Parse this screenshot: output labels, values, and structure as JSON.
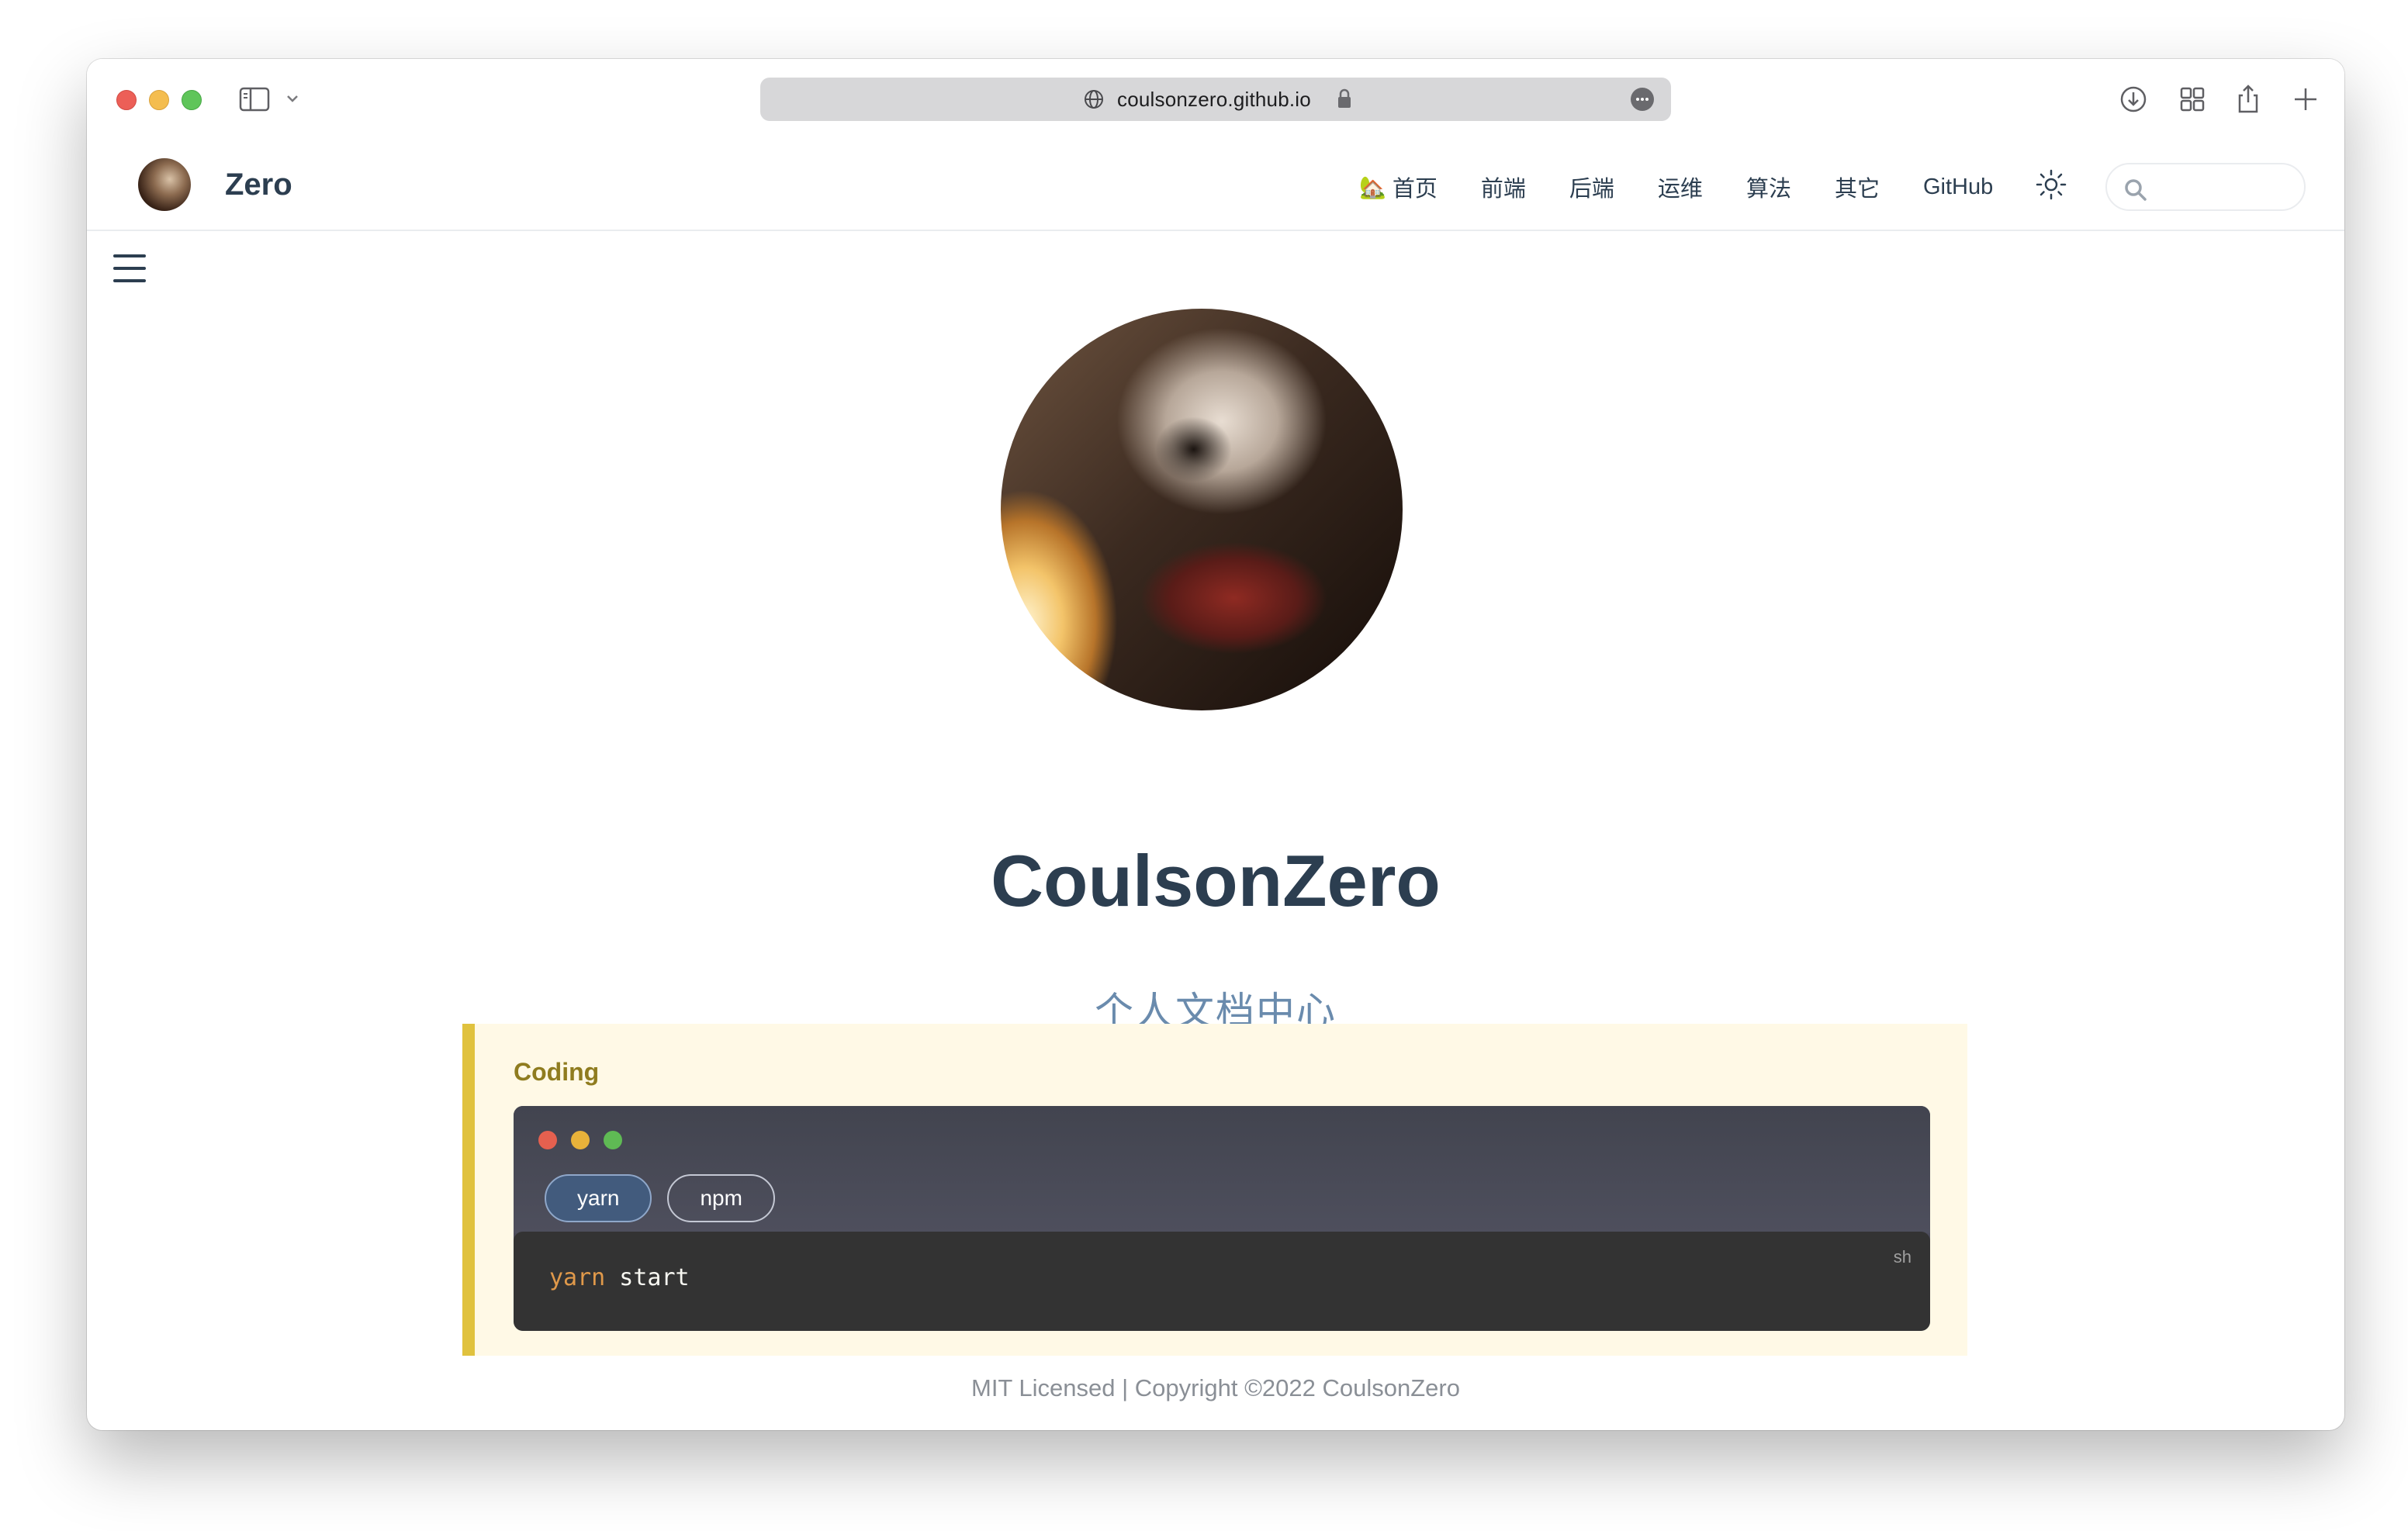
{
  "browser": {
    "url": "coulsonzero.github.io"
  },
  "navbar": {
    "site_name": "Zero",
    "links": [
      {
        "label": "首页",
        "icon": "home-icon"
      },
      {
        "label": "前端"
      },
      {
        "label": "后端"
      },
      {
        "label": "运维"
      },
      {
        "label": "算法"
      },
      {
        "label": "其它"
      },
      {
        "label": "GitHub"
      }
    ],
    "search_placeholder": ""
  },
  "hero": {
    "title": "CoulsonZero",
    "subtitle": "个人文档中心"
  },
  "tip": {
    "title": "Coding",
    "tabs": [
      "yarn",
      "npm"
    ],
    "active_tab": "yarn",
    "code_lang": "sh",
    "code_keyword": "yarn",
    "code_rest": " start"
  },
  "footer": {
    "text": "MIT Licensed | Copyright ©2022 CoulsonZero"
  },
  "colors": {
    "accent": "#e0c23e",
    "tip_bg": "#fff9e6",
    "text": "#2c3e50",
    "subtitle": "#6a8bad",
    "tab_active": "#425b7d",
    "code_bg": "#333333"
  }
}
